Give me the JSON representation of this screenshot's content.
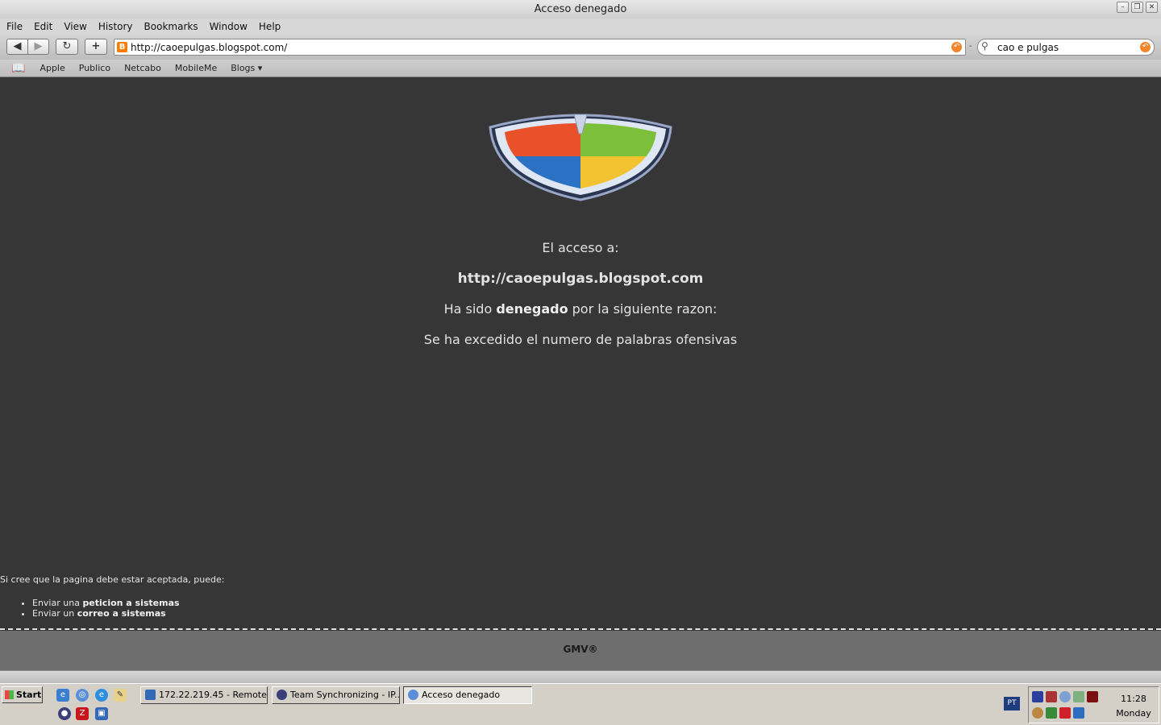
{
  "window": {
    "title": "Acceso denegado"
  },
  "menu": [
    "File",
    "Edit",
    "View",
    "History",
    "Bookmarks",
    "Window",
    "Help"
  ],
  "toolbar": {
    "url": "http://caoepulgas.blogspot.com/",
    "search_query": "cao e pulgas"
  },
  "bookmarks": [
    "Apple",
    "Publico",
    "Netcabo",
    "MobileMe",
    "Blogs ▾"
  ],
  "page": {
    "line1": "El acceso a:",
    "blocked_url": "http://caoepulgas.blogspot.com",
    "line3_pre": "Ha sido ",
    "line3_bold": "denegado",
    "line3_post": " por la siguiente razon:",
    "reason": "Se ha excedido el numero de palabras ofensivas",
    "note": "Si cree que la pagina debe estar aceptada, puede:",
    "options": [
      {
        "pre": "Enviar una ",
        "link": "peticion a sistemas"
      },
      {
        "pre": "Enviar un ",
        "link": "correo a sistemas"
      }
    ],
    "footer": "GMV®"
  },
  "taskbar": {
    "start": "Start",
    "tasks": [
      "172.22.219.45 - Remote...",
      "Team Synchronizing - IP...",
      "Acceso denegado"
    ],
    "language": "PT",
    "clock_time": "11:28",
    "clock_day": "Monday"
  },
  "colors": {
    "page_bg": "#363636",
    "footer_bg": "#6e6e6e",
    "accent_orange": "#f57d00"
  }
}
